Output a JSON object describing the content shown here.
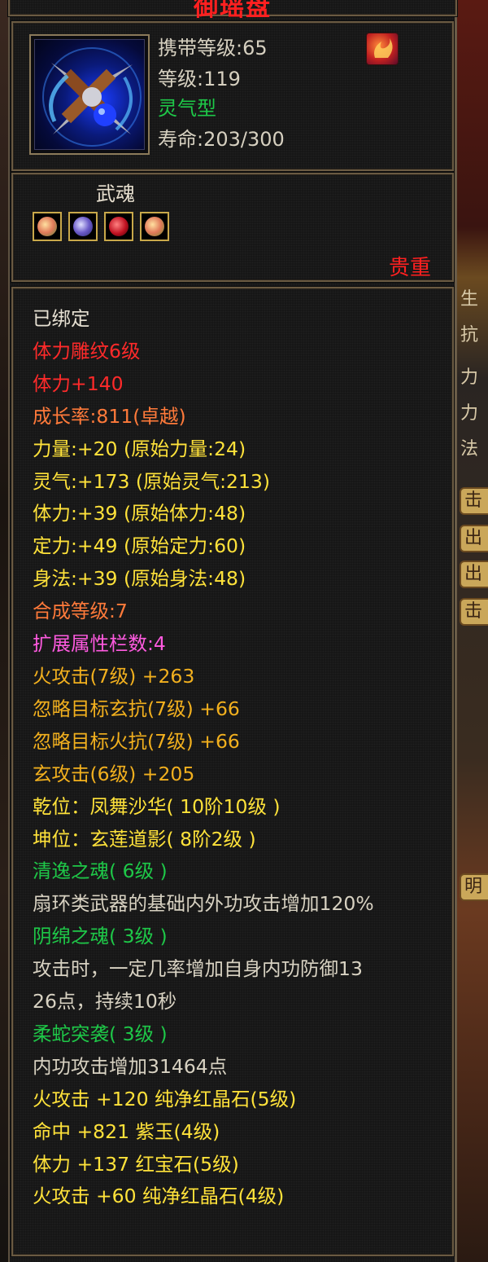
{
  "tooltip": {
    "title": "御瑶盘",
    "carry_level": "携带等级:65",
    "level": "等级:119",
    "type": "灵气型",
    "lifespan": "寿命:203/300",
    "soul_label": "武魂",
    "rarity": "贵重",
    "stats": [
      {
        "text": "已绑定",
        "color": "c-white"
      },
      {
        "text": "体力雕纹6级",
        "color": "c-red"
      },
      {
        "text": "体力+140",
        "color": "c-red"
      },
      {
        "text": "成长率:811(卓越)",
        "color": "c-orange"
      },
      {
        "text": "力量:+20 (原始力量:24)",
        "color": "c-yellow"
      },
      {
        "text": "灵气:+173 (原始灵气:213)",
        "color": "c-yellow"
      },
      {
        "text": "体力:+39 (原始体力:48)",
        "color": "c-yellow"
      },
      {
        "text": "定力:+49 (原始定力:60)",
        "color": "c-yellow"
      },
      {
        "text": "身法:+39 (原始身法:48)",
        "color": "c-yellow"
      },
      {
        "text": "合成等级:7",
        "color": "c-orange"
      },
      {
        "text": "扩展属性栏数:4",
        "color": "c-pink"
      },
      {
        "text": "火攻击(7级) +263",
        "color": "c-gold"
      },
      {
        "text": "忽略目标玄抗(7级) +66",
        "color": "c-gold"
      },
      {
        "text": "忽略目标火抗(7级) +66",
        "color": "c-gold"
      },
      {
        "text": "玄攻击(6级) +205",
        "color": "c-gold"
      },
      {
        "text": "乾位：凤舞沙华( 10阶10级 )",
        "color": "c-yellow"
      },
      {
        "text": "坤位：玄莲道影( 8阶2级 )",
        "color": "c-yellow"
      },
      {
        "text": "清逸之魂( 6级 )",
        "color": "c-green"
      },
      {
        "text": "扇环类武器的基础内外功攻击增加120%",
        "color": "c-grey"
      },
      {
        "text": "阴绵之魂( 3级 )",
        "color": "c-green"
      },
      {
        "text": "攻击时，一定几率增加自身内功防御13",
        "color": "c-grey"
      },
      {
        "text": "26点，持续10秒",
        "color": "c-grey"
      },
      {
        "text": "柔蛇突袭( 3级 )",
        "color": "c-green"
      },
      {
        "text": "内功攻击增加31464点",
        "color": "c-grey"
      },
      {
        "text": "火攻击 +120 纯净红晶石(5级)",
        "color": "c-yellow"
      },
      {
        "text": "命中 +821 紫玉(4级)",
        "color": "c-yellow"
      },
      {
        "text": "体力 +137 红宝石(5级)",
        "color": "c-yellow"
      },
      {
        "text": "火攻击 +60 纯净红晶石(4级)",
        "color": "c-yellow"
      }
    ]
  },
  "background": {
    "stat_glyphs": [
      "生",
      "抗",
      "力",
      "力",
      "法"
    ],
    "tabs": [
      "击",
      "出",
      "出",
      "击"
    ],
    "lower_tab": "明"
  },
  "colors": {
    "title": "#ff2020",
    "rarity": "#ff2020",
    "green": "#1ec848",
    "yellow": "#ffe23a"
  },
  "icons": {
    "item": "cross-bladed-disc-icon",
    "badge": "flame-badge-icon",
    "soul_gems": [
      "green-gem-icon",
      "blue-gem-icon",
      "red-gem-icon",
      "orange-gem-icon"
    ]
  }
}
